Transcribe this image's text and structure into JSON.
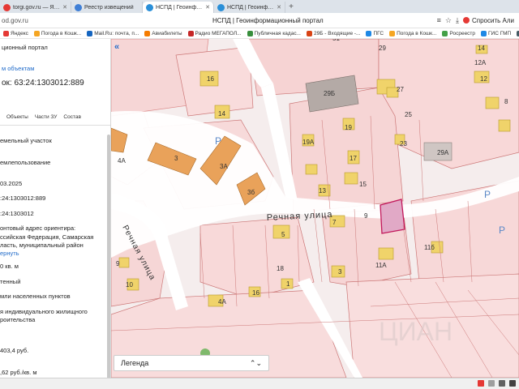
{
  "tabs": [
    {
      "label": "torgi.gov.ru — Яндекс:на",
      "icon_color": "#e53935",
      "active": false
    },
    {
      "label": "Реестр извещений",
      "icon_color": "#3f7fd6",
      "active": false
    },
    {
      "label": "НСПД | Геоинформацио",
      "icon_color": "#2a8fd8",
      "active": true
    },
    {
      "label": "НСПД | Геоинформацио",
      "icon_color": "#2a8fd8",
      "active": false
    }
  ],
  "new_tab": "+",
  "address": {
    "url": "od.gov.ru",
    "title": "НСПД | Геоинформационный портал",
    "ask_label": "Спросить Али"
  },
  "bookmarks": [
    {
      "label": "Яндекс",
      "color": "#e53935"
    },
    {
      "label": "Погода в Кошк...",
      "color": "#f5a623"
    },
    {
      "label": "Mail.Ru: почта, п...",
      "color": "#1565c0"
    },
    {
      "label": "Авиабилеты",
      "color": "#f57c00"
    },
    {
      "label": "Радио МЕГАПОЛ...",
      "color": "#c62828"
    },
    {
      "label": "Публичная кадас...",
      "color": "#388e3c"
    },
    {
      "label": "29Б - Входящие -...",
      "color": "#d84315"
    },
    {
      "label": "ПГС",
      "color": "#1e88e5"
    },
    {
      "label": "Погода в Кошк...",
      "color": "#f5a623"
    },
    {
      "label": "Росреестр",
      "color": "#43a047"
    },
    {
      "label": "ГИС ГМП",
      "color": "#1e88e5"
    },
    {
      "label": "Личный кабинет",
      "color": "#455a64"
    }
  ],
  "panel": {
    "portal_name": "ционный портал",
    "back_link": "м объектам",
    "cadastral": "ок: 63:24:1303012:889",
    "tabs": [
      "",
      "Объекты",
      "Части ЗУ",
      "Состав"
    ],
    "rows": [
      "емельный участок",
      "емлепользование",
      "03.2025",
      ":24:1303012:889",
      ":24:1303012",
      "онтовый адрес ориентира:",
      "ссийская Федерация, Самарская",
      "ласть, муниципальный район",
      "ернуть",
      "0 кв. м",
      "тенный",
      "мли населенных пунктов",
      "я индивидуального жилищного",
      "роительства",
      "403,4 руб.",
      ",62 руб./кв. м"
    ]
  },
  "map": {
    "street_main": "Речная улица",
    "street_side": "Речная улица",
    "parcels": [
      "16",
      "14",
      "4А",
      "3",
      "3А",
      "3б",
      "29",
      "29Б",
      "27",
      "25",
      "19",
      "19А",
      "17",
      "23",
      "29А",
      "15",
      "13",
      "5",
      "7",
      "9",
      "3",
      "11А",
      "11б",
      "9",
      "10",
      "4А",
      "16",
      "1",
      "18",
      "14",
      "12А",
      "12",
      "8",
      "51"
    ],
    "parking_label": "P",
    "watermark": "ЦИАН",
    "accent_color": "#c2185b"
  },
  "legend": {
    "label": "Легенда",
    "chevron": "⌃⌄"
  }
}
